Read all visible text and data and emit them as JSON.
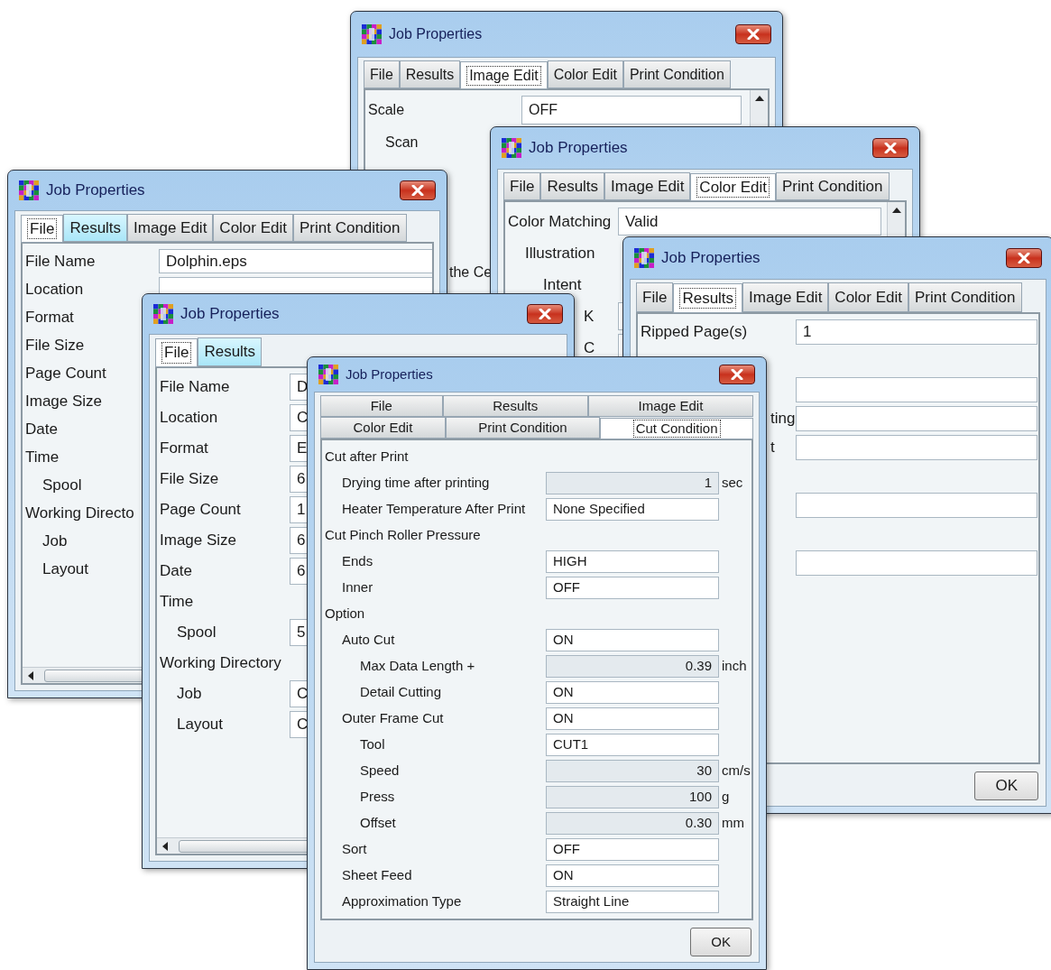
{
  "windows": [
    {
      "title": "Job Properties",
      "tab_rows": [
        [
          {
            "label": "File",
            "selected": false,
            "hovered": false
          },
          {
            "label": "Results",
            "selected": false,
            "hovered": false
          },
          {
            "label": "Image Edit",
            "selected": true,
            "hovered": false
          },
          {
            "label": "Color Edit",
            "selected": false,
            "hovered": false
          },
          {
            "label": "Print Condition",
            "selected": false,
            "hovered": false
          }
        ]
      ],
      "rows": [
        {
          "kind": "field",
          "label": "Scale",
          "value": "OFF",
          "children": [
            {
              "kind": "heading",
              "label": "Scan"
            }
          ]
        },
        {
          "kind": "blank"
        },
        {
          "kind": "blank"
        },
        {
          "kind": "blank"
        },
        {
          "kind": "fragment",
          "label": "the Ce"
        }
      ]
    },
    {
      "title": "Job Properties",
      "tab_rows": [
        [
          {
            "label": "File",
            "selected": false,
            "hovered": false
          },
          {
            "label": "Results",
            "selected": false,
            "hovered": false
          },
          {
            "label": "Image Edit",
            "selected": false,
            "hovered": false
          },
          {
            "label": "Color Edit",
            "selected": true,
            "hovered": false
          },
          {
            "label": "Print Condition",
            "selected": false,
            "hovered": false
          }
        ]
      ],
      "rows": [
        {
          "kind": "field",
          "label": "Color Matching",
          "value": "Valid",
          "children": [
            {
              "kind": "heading",
              "label": "Illustration",
              "children": [
                {
                  "kind": "heading",
                  "label": "Intent"
                }
              ]
            }
          ]
        },
        {
          "kind": "fragment",
          "label": "K"
        },
        {
          "kind": "fragment",
          "label": "C"
        }
      ]
    },
    {
      "title": "Job Properties",
      "tab_rows": [
        [
          {
            "label": "File",
            "selected": true,
            "hovered": false
          },
          {
            "label": "Results",
            "selected": false,
            "hovered": true
          },
          {
            "label": "Image Edit",
            "selected": false,
            "hovered": false
          },
          {
            "label": "Color Edit",
            "selected": false,
            "hovered": false
          },
          {
            "label": "Print Condition",
            "selected": false,
            "hovered": false
          }
        ]
      ],
      "rows": [
        {
          "kind": "field",
          "label": "File Name",
          "value": "Dolphin.eps"
        },
        {
          "kind": "field",
          "label": "Location"
        },
        {
          "kind": "heading",
          "label": "Format"
        },
        {
          "kind": "heading",
          "label": "File Size"
        },
        {
          "kind": "heading",
          "label": "Page Count"
        },
        {
          "kind": "heading",
          "label": "Image Size"
        },
        {
          "kind": "heading",
          "label": "Date"
        },
        {
          "kind": "heading",
          "label": "Time",
          "children": [
            {
              "kind": "heading",
              "label": "Spool"
            }
          ]
        },
        {
          "kind": "heading",
          "label": "Working Directo",
          "children": [
            {
              "kind": "heading",
              "label": "Job"
            },
            {
              "kind": "heading",
              "label": "Layout"
            }
          ]
        }
      ]
    },
    {
      "title": "Job Properties",
      "tab_rows": [
        [
          {
            "label": "File",
            "selected": true,
            "hovered": false
          },
          {
            "label": "Results",
            "selected": false,
            "hovered": true
          }
        ]
      ],
      "rows": [
        {
          "kind": "field",
          "label": "File Name",
          "value": "D"
        },
        {
          "kind": "field",
          "label": "Location",
          "value": "C"
        },
        {
          "kind": "field",
          "label": "Format",
          "value": "E"
        },
        {
          "kind": "field",
          "label": "File Size",
          "value": "6"
        },
        {
          "kind": "field",
          "label": "Page Count",
          "value": "1"
        },
        {
          "kind": "field",
          "label": "Image Size",
          "value": "6"
        },
        {
          "kind": "field",
          "label": "Date",
          "value": "6"
        },
        {
          "kind": "heading",
          "label": "Time",
          "children": [
            {
              "kind": "field",
              "label": "Spool",
              "value": "5"
            }
          ]
        },
        {
          "kind": "heading",
          "label": "Working Directory",
          "children": [
            {
              "kind": "field",
              "label": "Job",
              "value": "C"
            },
            {
              "kind": "field",
              "label": "Layout",
              "value": "C"
            }
          ]
        }
      ]
    },
    {
      "title": "Job Properties",
      "tab_rows": [
        [
          {
            "label": "File",
            "selected": false,
            "hovered": false
          },
          {
            "label": "Results",
            "selected": true,
            "hovered": false
          },
          {
            "label": "Image Edit",
            "selected": false,
            "hovered": false
          },
          {
            "label": "Color Edit",
            "selected": false,
            "hovered": false
          },
          {
            "label": "Print Condition",
            "selected": false,
            "hovered": false
          }
        ]
      ],
      "rows": [
        {
          "kind": "field",
          "label": "Ripped Page(s)",
          "value": "1"
        },
        {
          "kind": "blank"
        },
        {
          "kind": "field"
        },
        {
          "kind": "fragment",
          "label": "ting"
        },
        {
          "kind": "fragment",
          "label": "t"
        },
        {
          "kind": "blank"
        },
        {
          "kind": "field"
        },
        {
          "kind": "blank"
        },
        {
          "kind": "field"
        }
      ],
      "ok_button": "OK"
    },
    {
      "title": "Job Properties",
      "tab_rows": [
        [
          {
            "label": "File",
            "selected": false,
            "hovered": false
          },
          {
            "label": "Results",
            "selected": false,
            "hovered": false
          },
          {
            "label": "Image Edit",
            "selected": false,
            "hovered": false
          }
        ],
        [
          {
            "label": "Color Edit",
            "selected": false,
            "hovered": false
          },
          {
            "label": "Print Condition",
            "selected": false,
            "hovered": false
          },
          {
            "label": "Cut Condition",
            "selected": true,
            "hovered": false
          }
        ]
      ],
      "rows": [
        {
          "kind": "heading",
          "label": "Cut after Print",
          "children": [
            {
              "kind": "number",
              "label": "Drying time after printing",
              "value": "1",
              "unit": "sec"
            },
            {
              "kind": "field",
              "label": "Heater Temperature After Print",
              "value": "None Specified"
            }
          ]
        },
        {
          "kind": "heading",
          "label": "Cut Pinch Roller Pressure",
          "children": [
            {
              "kind": "field",
              "label": "Ends",
              "value": "HIGH"
            },
            {
              "kind": "field",
              "label": "Inner",
              "value": "OFF"
            }
          ]
        },
        {
          "kind": "heading",
          "label": "Option",
          "children": [
            {
              "kind": "field",
              "label": "Auto Cut",
              "value": "ON",
              "children": [
                {
                  "kind": "number",
                  "label": "Max Data Length +",
                  "value": "0.39",
                  "unit": "inch"
                },
                {
                  "kind": "field",
                  "label": "Detail Cutting",
                  "value": "ON"
                }
              ]
            },
            {
              "kind": "field",
              "label": "Outer Frame Cut",
              "value": "ON",
              "children": [
                {
                  "kind": "field",
                  "label": "Tool",
                  "value": "CUT1"
                },
                {
                  "kind": "number",
                  "label": "Speed",
                  "value": "30",
                  "unit": "cm/s"
                },
                {
                  "kind": "number",
                  "label": "Press",
                  "value": "100",
                  "unit": "g"
                },
                {
                  "kind": "number",
                  "label": "Offset",
                  "value": "0.30",
                  "unit": "mm"
                }
              ]
            },
            {
              "kind": "field",
              "label": "Sort",
              "value": "OFF"
            },
            {
              "kind": "field",
              "label": "Sheet Feed",
              "value": "ON"
            },
            {
              "kind": "field",
              "label": "Approximation Type",
              "value": "Straight Line"
            }
          ]
        }
      ],
      "ok_button": "OK"
    }
  ]
}
